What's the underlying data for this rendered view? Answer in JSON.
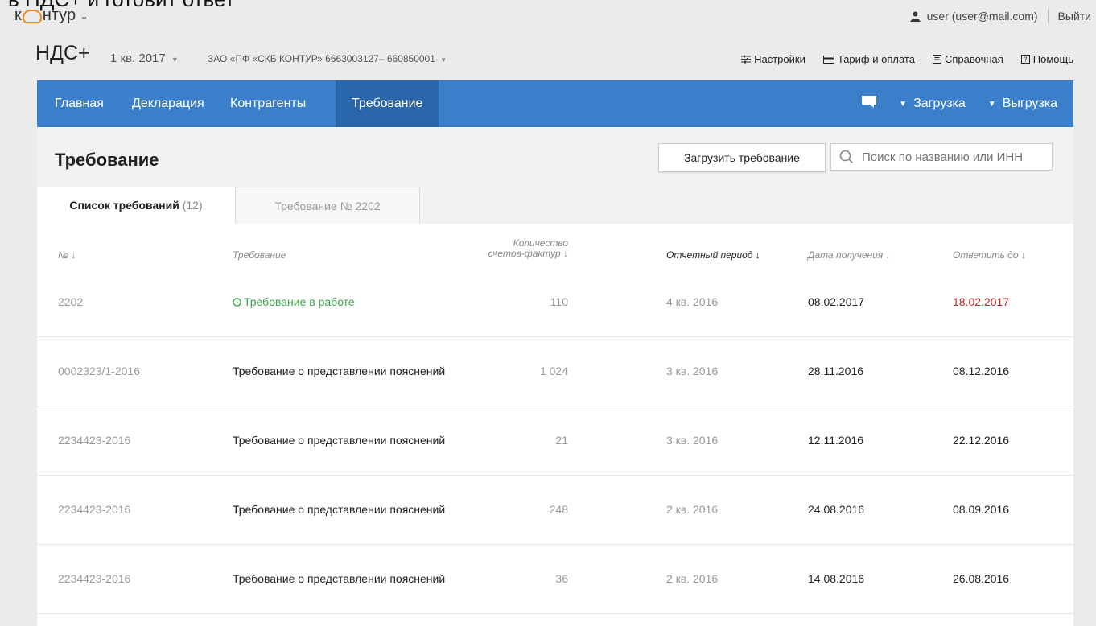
{
  "cut_text": "в НДС+ и готовит ответ",
  "topbar": {
    "logo_left": "к",
    "logo_right": "нтур",
    "user": "user (user@mail.com)",
    "logout": "Выйти"
  },
  "header": {
    "product": "НДС+",
    "period": "1 кв. 2017",
    "company": "ЗАО «ПФ «СКБ КОНТУР» 6663003127– 660850001",
    "links": [
      "Настройки",
      "Тариф и оплата",
      "Справочная",
      "Помощь"
    ]
  },
  "nav": {
    "items": [
      "Главная",
      "Декларация",
      "Контрагенты",
      "Требование"
    ],
    "active_index": 3,
    "upload": "Загрузка",
    "download": "Выгрузка"
  },
  "page": {
    "title": "Требование",
    "load_button": "Загрузить требование",
    "search_placeholder": "Поиск по названию или ИНН"
  },
  "tabs": {
    "list_label": "Список требований",
    "list_count": "(12)",
    "detail_label": "Требование № 2202"
  },
  "table": {
    "headers": {
      "num": "№ ↓",
      "req": "Требование",
      "qty_line1": "Количество",
      "qty_line2": "счетов-фактур ↓",
      "period": "Отчетный период ↓",
      "received": "Дата получения ↓",
      "due": "Ответить до ↓"
    },
    "rows": [
      {
        "num": "2202",
        "req": "Требование в работе",
        "qty": "110",
        "period": "4 кв. 2016",
        "received": "08.02.2017",
        "due": "18.02.2017"
      },
      {
        "num": "0002323/1-2016",
        "req": "Требование о представлении пояснений",
        "qty": "1 024",
        "period": "3 кв. 2016",
        "received": "28.11.2016",
        "due": "08.12.2016"
      },
      {
        "num": "2234423-2016",
        "req": "Требование о представлении пояснений",
        "qty": "21",
        "period": "3 кв. 2016",
        "received": "12.11.2016",
        "due": "22.12.2016"
      },
      {
        "num": "2234423-2016",
        "req": "Требование о представлении пояснений",
        "qty": "248",
        "period": "2 кв. 2016",
        "received": "24.08.2016",
        "due": "08.09.2016"
      },
      {
        "num": "2234423-2016",
        "req": "Требование о представлении пояснений",
        "qty": "36",
        "period": "2 кв. 2016",
        "received": "14.08.2016",
        "due": "26.08.2016"
      }
    ]
  },
  "colors": {
    "nav_bg": "#3b7fcb",
    "nav_active": "#2a66aa",
    "in_progress": "#3aa34a",
    "overdue": "#c0282c",
    "logo_accent": "#f08a24"
  }
}
